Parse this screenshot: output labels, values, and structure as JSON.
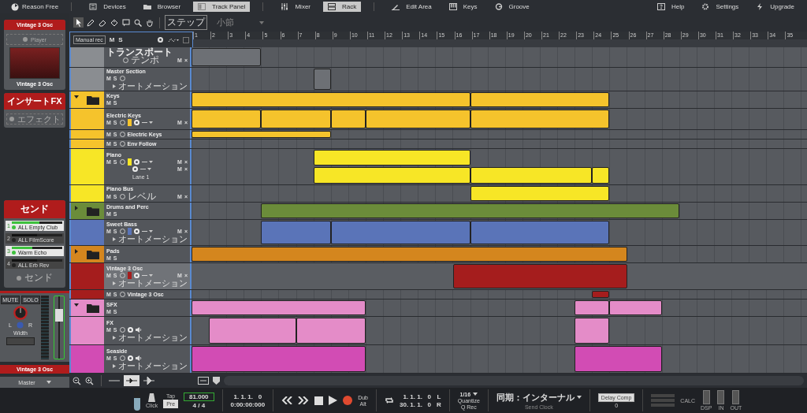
{
  "top_bar": {
    "app": "Reason Free",
    "items": [
      {
        "label": "Devices",
        "selected": false
      },
      {
        "label": "Browser",
        "selected": false
      },
      {
        "label": "Track Panel",
        "selected": true
      },
      {
        "label": "Mixer",
        "selected": false
      },
      {
        "label": "Rack",
        "selected": true
      },
      {
        "label": "Edit Area",
        "selected": false
      },
      {
        "label": "Keys",
        "selected": false
      },
      {
        "label": "Groove",
        "selected": false
      }
    ],
    "right": [
      "Help",
      "Settings",
      "Upgrade"
    ]
  },
  "toolbar": {
    "tools": [
      {
        "selected": true
      },
      {
        "selected": false
      },
      {
        "selected": false
      },
      {
        "selected": false
      },
      {
        "selected": false
      },
      {
        "selected": false
      },
      {
        "selected": false
      }
    ],
    "snap_button": "ステップ",
    "snap_value": "小節"
  },
  "device_panel": {
    "title": "Vintage 3 Osc",
    "player_button": "Player",
    "device_name": "Vintage 3 Osc",
    "insert_title": "インサートFX",
    "effect_button": "エフェクト",
    "send_title": "センド",
    "sends": [
      {
        "number": "1",
        "name": "ALL Empty Club",
        "on": true,
        "level": 0.55
      },
      {
        "number": "2",
        "name": "ALL FilmScore",
        "on": false,
        "level": 0.5
      },
      {
        "number": "3",
        "name": "Warm Echo",
        "on": true,
        "level": 0.4
      },
      {
        "number": "4",
        "name": "ALL Erb Rev",
        "on": false,
        "level": 0.5
      }
    ],
    "send_button": "センド"
  },
  "channel_strip": {
    "mute": "MUTE",
    "solo": "SOLO",
    "pan_left": "L",
    "pan_right": "R",
    "width_label": "Width",
    "fader": {
      "level": 0.72
    },
    "name": "Vintage 3 Osc",
    "output": "Master"
  },
  "track_header": {
    "manual_rec": "Manual rec",
    "mute": "M",
    "solo": "S"
  },
  "ruler": [
    "1",
    "2",
    "3",
    "4",
    "5",
    "6",
    "7",
    "8",
    "9",
    "10",
    "11",
    "12",
    "13",
    "14",
    "15",
    "16",
    "17",
    "18",
    "19",
    "20",
    "21",
    "22",
    "23",
    "24",
    "25",
    "26",
    "27",
    "28",
    "29",
    "30",
    "31",
    "32",
    "33",
    "34",
    "35"
  ],
  "tracks": [
    {
      "kind": "transport",
      "name": "トランスポート",
      "sub": "テンポ",
      "color": "#8a8d91",
      "selected": false,
      "end_controls": [
        "M",
        "×"
      ]
    },
    {
      "kind": "master",
      "name": "Master Section",
      "automation": "オートメーション",
      "color": "#8a8d91",
      "selected": false,
      "controls": [
        "M",
        "S"
      ]
    },
    {
      "kind": "folder",
      "name": "Keys",
      "expanded": true,
      "color": "#f5c32c",
      "selected": false,
      "controls": [
        "M",
        "S"
      ]
    },
    {
      "kind": "instrument",
      "name": "Electric Keys",
      "color": "#f5c32c",
      "selected": false,
      "controls": [
        "M",
        "S"
      ],
      "end_controls": [
        "M",
        "×"
      ]
    },
    {
      "kind": "mix",
      "name": "Electric Keys",
      "color": "#f5c32c",
      "selected": false,
      "controls": [
        "M",
        "S"
      ]
    },
    {
      "kind": "mix",
      "name": "Env Follow",
      "color": "#f5c32c",
      "selected": false,
      "controls": [
        "M",
        "S"
      ]
    },
    {
      "kind": "instrument",
      "name": "Piano",
      "color": "#f7e626",
      "selected": false,
      "controls": [
        "M",
        "S"
      ],
      "end_controls": [
        "M",
        "×"
      ],
      "lane": {
        "name": "Lane 1",
        "end_controls": [
          "M",
          "×"
        ]
      }
    },
    {
      "kind": "bus",
      "name": "Piano Bus",
      "sub": "レベル",
      "color": "#f7e626",
      "selected": false,
      "controls": [
        "M",
        "S"
      ],
      "end_controls": [
        "M",
        "×"
      ]
    },
    {
      "kind": "folder",
      "name": "Drums and Perc",
      "expanded": false,
      "color": "#6b8c3a",
      "selected": false,
      "controls": [
        "M",
        "S"
      ]
    },
    {
      "kind": "instrument",
      "name": "Sweet Bass",
      "automation": "オートメーション",
      "color": "#5a74b8",
      "selected": false,
      "controls": [
        "M",
        "S"
      ],
      "end_controls": [
        "M",
        "×"
      ]
    },
    {
      "kind": "folder",
      "name": "Pads",
      "expanded": false,
      "color": "#d4861e",
      "selected": false,
      "controls": [
        "M",
        "S"
      ]
    },
    {
      "kind": "instrument",
      "name": "Vintage 3 Osc",
      "automation": "オートメーション",
      "color": "#a51d1d",
      "selected": true,
      "controls": [
        "M",
        "S"
      ],
      "end_controls": [
        "M",
        "×"
      ]
    },
    {
      "kind": "mix",
      "name": "Vintage 3 Osc",
      "color": "#a51d1d",
      "selected": false,
      "controls": [
        "M",
        "S"
      ]
    },
    {
      "kind": "folder",
      "name": "SFX",
      "expanded": true,
      "color": "#e48cc8",
      "selected": false,
      "controls": [
        "M",
        "S"
      ]
    },
    {
      "kind": "audio",
      "name": "FX",
      "automation": "オートメーション",
      "color": "#e48cc8",
      "selected": false,
      "controls": [
        "M",
        "S"
      ]
    },
    {
      "kind": "audio",
      "name": "Seaside",
      "automation": "オートメーション",
      "color": "#d24cb4",
      "selected": false,
      "controls": [
        "M",
        "S"
      ]
    }
  ],
  "transport": {
    "metronome": {
      "level": 0.6
    },
    "click": "Click",
    "tap": "Tap",
    "pre": "Pre",
    "tempo": "81.000",
    "signature": "4 / 4",
    "position": "1. 1. 1.   0",
    "time": "0:00:00:000",
    "dub": "Dub",
    "alt": "Alt",
    "left_locator": "1. 1. 1.   0",
    "left_label": "L",
    "right_locator": "30. 1. 1.   0",
    "right_label": "R",
    "quantize_value": "1/16",
    "quantize": "Quantize",
    "q_rec": "Q Rec",
    "sync": "同期：インターナル",
    "send_clock": "Send Clock",
    "delay_comp": "Delay Comp",
    "delay_value": "0",
    "calc": "CALC",
    "dsp": "DSP",
    "in": "IN",
    "out": "OUT"
  }
}
